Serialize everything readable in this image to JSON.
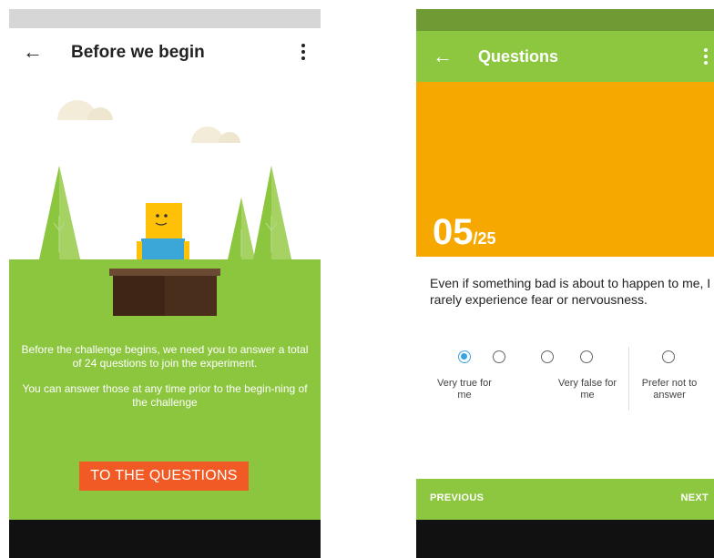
{
  "screen1": {
    "title": "Before we begin",
    "body_paragraph_1": "Before the challenge begins, we need you to answer a total of 24 questions to join the experiment.",
    "body_paragraph_2": "You can answer those at any time prior to the begin-ning of the challenge",
    "cta_label": "TO THE QUESTIONS",
    "icons": {
      "back": "back-arrow-icon",
      "more": "more-vert-icon"
    },
    "colors": {
      "ground": "#8cc63f",
      "cta": "#f15a24",
      "character": "#ffc107"
    }
  },
  "screen2": {
    "title": "Questions",
    "counter_current": "05",
    "counter_total": "/25",
    "question": "Even if something bad is about to happen to me, I rarely experience fear or nervousness.",
    "options": {
      "left_label": "Very true for me",
      "right_label": "Very false for me",
      "prefer_label": "Prefer not to answer",
      "selected_index": 0
    },
    "previous_label": "PREVIOUS",
    "next_label": "NEXT",
    "icons": {
      "back": "back-arrow-icon",
      "more": "more-vert-icon"
    },
    "colors": {
      "appbar": "#8dc63f",
      "hero": "#f7a800",
      "selected": "#3ba2e1"
    }
  }
}
